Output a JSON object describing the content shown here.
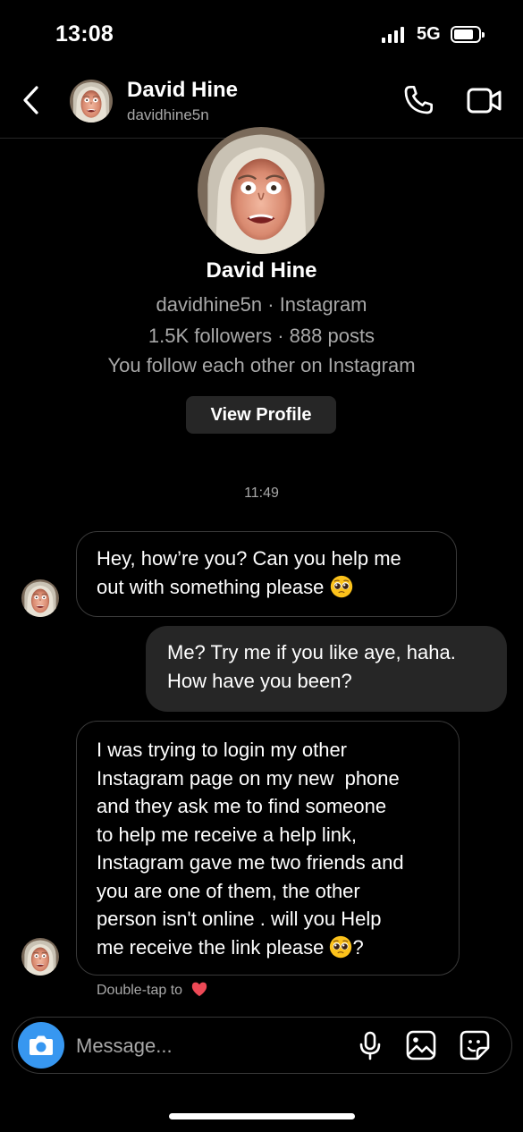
{
  "status_bar": {
    "time": "13:08",
    "network": "5G"
  },
  "header": {
    "name": "David Hine",
    "username": "davidhine5n"
  },
  "profile": {
    "name": "David Hine",
    "handle_line": "davidhine5n · Instagram",
    "stats_line": "1.5K followers · 888 posts",
    "mutual_line": "You follow each other on Instagram",
    "view_profile_label": "View Profile"
  },
  "timestamp": "11:49",
  "messages": [
    {
      "from": "them",
      "line1": "Hey, how’re you? Can you help me",
      "line2": "out with something please"
    },
    {
      "from": "me",
      "line1": "Me? Try me if you like aye, haha.",
      "line2": "How have you been?"
    },
    {
      "from": "them",
      "lines": [
        "I was trying to login my other",
        "Instagram page on my new  phone",
        "and they ask me to find someone",
        "to help me receive a help link,",
        "Instagram gave me two friends and",
        "you are one of them, the other",
        "person isn't online . will you Help",
        "me receive the link please"
      ],
      "tail": "?"
    }
  ],
  "double_tap_hint": "Double-tap to",
  "composer": {
    "placeholder": "Message..."
  },
  "colors": {
    "accent": "#3797f0",
    "incoming_border": "#3a3a3a",
    "outgoing_bg": "#262626",
    "heart": "#ed4956"
  },
  "icons": [
    "back-chevron-icon",
    "phone-icon",
    "video-camera-icon",
    "camera-icon",
    "microphone-icon",
    "gallery-icon",
    "sticker-icon",
    "heart-icon",
    "pleading-face-emoji"
  ]
}
